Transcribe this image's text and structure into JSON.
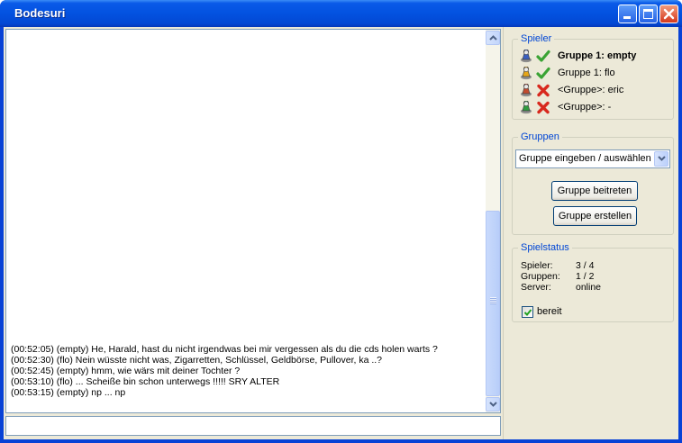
{
  "window": {
    "title": "Bodesuri"
  },
  "chat": {
    "lines": [
      "(00:52:05) (empty) He, Harald, hast du nicht irgendwas bei mir vergessen als du die cds holen warts ?",
      "(00:52:30) (flo) Nein wüsste nicht was, Zigarretten, Schlüssel, Geldbörse, Pullover, ka ..?",
      "(00:52:45) (empty) hmm, wie wärs mit deiner Tochter ?",
      "(00:53:10) (flo) ... Scheiße bin schon unterwegs !!!!! SRY ALTER",
      "(00:53:15) (empty) np ... np"
    ],
    "input_value": ""
  },
  "spieler": {
    "legend": "Spieler",
    "players": [
      {
        "name": "Gruppe 1: empty",
        "color": "#3a5fc0",
        "ready": true,
        "bold": true
      },
      {
        "name": "Gruppe 1: flo",
        "color": "#e6a617",
        "ready": true,
        "bold": false
      },
      {
        "name": "<Gruppe>: eric",
        "color": "#c24a2e",
        "ready": false,
        "bold": false
      },
      {
        "name": "<Gruppe>: -",
        "color": "#2f9b3f",
        "ready": false,
        "bold": false
      }
    ]
  },
  "gruppen": {
    "legend": "Gruppen",
    "select_value": "Gruppe eingeben / auswählen",
    "join_label": "Gruppe beitreten",
    "create_label": "Gruppe erstellen"
  },
  "spielstatus": {
    "legend": "Spielstatus",
    "rows": [
      {
        "key": "Spieler:",
        "value": "3 / 4"
      },
      {
        "key": "Gruppen:",
        "value": "1 / 2"
      },
      {
        "key": "Server:",
        "value": "online"
      }
    ],
    "ready_label": "bereit",
    "ready_checked": true
  },
  "colors": {
    "accent": "#0046d5",
    "ready": "#3aa334",
    "not_ready": "#d8291e"
  }
}
